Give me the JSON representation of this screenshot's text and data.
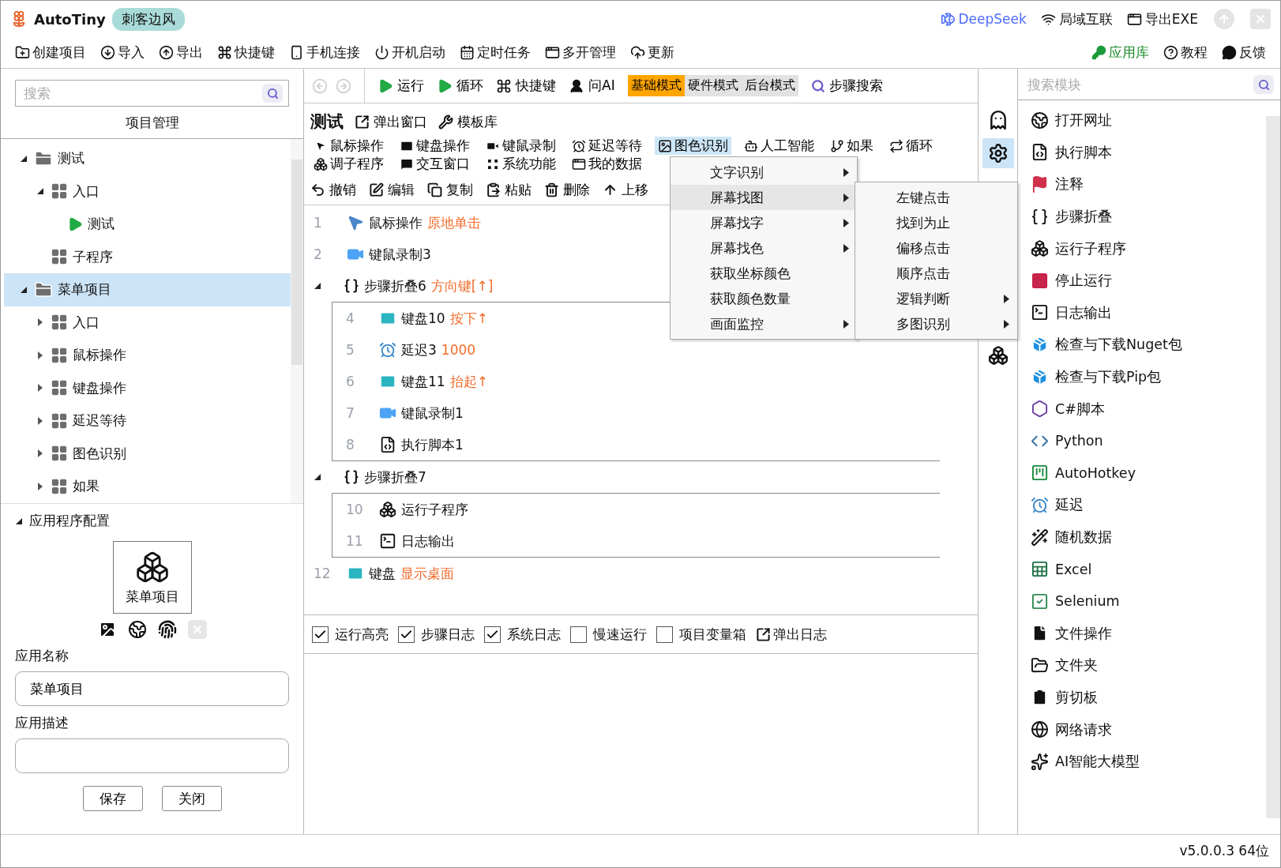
{
  "title_bar": {
    "app_name": "AutoTiny",
    "user_badge": "刺客边风",
    "links": [
      "DeepSeek",
      "局域互联",
      "导出EXE"
    ]
  },
  "menu_bar": {
    "items": [
      "创建项目",
      "导入",
      "导出",
      "快捷键",
      "手机连接",
      "开机启动",
      "定时任务",
      "多开管理",
      "更新"
    ],
    "right_items": [
      "应用库",
      "教程",
      "反馈"
    ]
  },
  "project_panel": {
    "search": {
      "placeholder": "搜索"
    },
    "title": "项目管理",
    "tree": [
      {
        "kind": "project",
        "label": "测试",
        "expanded": true,
        "selected": false,
        "children": [
          {
            "kind": "group",
            "label": "入口",
            "expanded": true,
            "selected": false,
            "children": [
              {
                "kind": "script",
                "label": "测试",
                "selected": false
              }
            ]
          },
          {
            "kind": "group",
            "label": "子程序",
            "selected": false
          }
        ]
      },
      {
        "kind": "project",
        "label": "菜单项目",
        "expanded": true,
        "selected": true,
        "children": [
          {
            "kind": "group",
            "label": "入口",
            "expanded": false,
            "selected": false
          },
          {
            "kind": "group",
            "label": "鼠标操作",
            "expanded": false,
            "selected": false
          },
          {
            "kind": "group",
            "label": "键盘操作",
            "expanded": false,
            "selected": false
          },
          {
            "kind": "group",
            "label": "延迟等待",
            "expanded": false,
            "selected": false
          },
          {
            "kind": "group",
            "label": "图色识别",
            "expanded": false,
            "selected": false
          },
          {
            "kind": "group",
            "label": "如果",
            "expanded": false,
            "selected": false
          }
        ]
      }
    ]
  },
  "app_config": {
    "title": "应用程序配置",
    "expanded": true,
    "app_tile": "菜单项目",
    "name_label": "应用名称",
    "name_value": "菜单项目",
    "description_label": "应用描述",
    "buttons": [
      "保存",
      "关闭"
    ]
  },
  "toolbar": {
    "actions": [
      "运行",
      "循环",
      "快捷键",
      "问AI"
    ],
    "modes": [
      {
        "label": "基础模式",
        "selected": true
      },
      {
        "label": "硬件模式",
        "selected": false
      },
      {
        "label": "后台模式",
        "selected": false
      }
    ],
    "search_button": "步骤搜索"
  },
  "editor": {
    "title": "测试",
    "header_actions": [
      "弹出窗口",
      "模板库"
    ],
    "category_rows": [
      [
        {
          "label": "鼠标操作",
          "selected": false
        },
        {
          "label": "键盘操作",
          "selected": false
        },
        {
          "label": "键鼠录制",
          "selected": false
        },
        {
          "label": "延迟等待",
          "selected": false
        },
        {
          "label": "图色识别",
          "selected": true
        },
        {
          "label": "人工智能",
          "selected": false
        },
        {
          "label": "如果",
          "selected": false
        },
        {
          "label": "循环",
          "selected": false
        }
      ],
      [
        {
          "label": "调子程序",
          "selected": false
        },
        {
          "label": "交互窗口",
          "selected": false
        },
        {
          "label": "系统功能",
          "selected": false
        },
        {
          "label": "我的数据",
          "selected": false
        }
      ]
    ],
    "edit_actions": [
      "撤销",
      "编辑",
      "复制",
      "粘贴",
      "删除",
      "上移"
    ],
    "steps": [
      {
        "kind": "step",
        "number": "1",
        "name": "鼠标操作",
        "param": "原地单击"
      },
      {
        "kind": "step",
        "number": "2",
        "name": "键鼠录制3"
      },
      {
        "kind": "fold",
        "name": "步骤折叠6",
        "param": "方向键[↑]",
        "expanded": true,
        "children": [
          {
            "kind": "step",
            "number": "4",
            "name": "键盘10",
            "param": "按下↑"
          },
          {
            "kind": "step",
            "number": "5",
            "name": "延迟3",
            "param": "1000"
          },
          {
            "kind": "step",
            "number": "6",
            "name": "键盘11",
            "param": "抬起↑"
          },
          {
            "kind": "step",
            "number": "7",
            "name": "键鼠录制1"
          },
          {
            "kind": "step",
            "number": "8",
            "name": "执行脚本1"
          }
        ]
      },
      {
        "kind": "fold",
        "name": "步骤折叠7",
        "expanded": true,
        "children": [
          {
            "kind": "step",
            "number": "10",
            "name": "运行子程序"
          },
          {
            "kind": "step",
            "number": "11",
            "name": "日志输出"
          }
        ]
      },
      {
        "kind": "step",
        "number": "12",
        "name": "键盘",
        "param": "显示桌面"
      }
    ],
    "options": [
      {
        "label": "运行高亮",
        "checked": true
      },
      {
        "label": "步骤日志",
        "checked": true
      },
      {
        "label": "系统日志",
        "checked": true
      },
      {
        "label": "慢速运行",
        "checked": false
      },
      {
        "label": "项目变量箱",
        "checked": false
      }
    ],
    "popup_log": "弹出日志"
  },
  "context_menu": {
    "items": [
      {
        "label": "文字识别",
        "submenu": true,
        "selected": false
      },
      {
        "label": "屏幕找图",
        "submenu": true,
        "selected": true
      },
      {
        "label": "屏幕找字",
        "submenu": true,
        "selected": false
      },
      {
        "label": "屏幕找色",
        "submenu": true,
        "selected": false
      },
      {
        "label": "获取坐标颜色",
        "submenu": false,
        "selected": false
      },
      {
        "label": "获取颜色数量",
        "submenu": false,
        "selected": false
      },
      {
        "label": "画面监控",
        "submenu": true,
        "selected": false
      }
    ],
    "submenu": [
      {
        "label": "左键点击",
        "submenu": false
      },
      {
        "label": "找到为止",
        "submenu": false
      },
      {
        "label": "偏移点击",
        "submenu": false
      },
      {
        "label": "顺序点击",
        "submenu": false
      },
      {
        "label": "逻辑判断",
        "submenu": true
      },
      {
        "label": "多图识别",
        "submenu": true
      }
    ]
  },
  "icon_strip": [
    {
      "selected": false
    },
    {
      "selected": true
    },
    {
      "selected": false
    }
  ],
  "module_panel": {
    "search": {
      "placeholder": "搜索模块"
    },
    "items": [
      "打开网址",
      "执行脚本",
      "注释",
      "步骤折叠",
      "运行子程序",
      "停止运行",
      "日志输出",
      "检查与下载Nuget包",
      "检查与下载Pip包",
      "C#脚本",
      "Python",
      "AutoHotkey",
      "延迟",
      "随机数据",
      "Excel",
      "Selenium",
      "文件操作",
      "文件夹",
      "剪切板",
      "网络请求",
      "AI智能大模型"
    ]
  },
  "status_bar": {
    "version": "v5.0.0.3 64位"
  }
}
